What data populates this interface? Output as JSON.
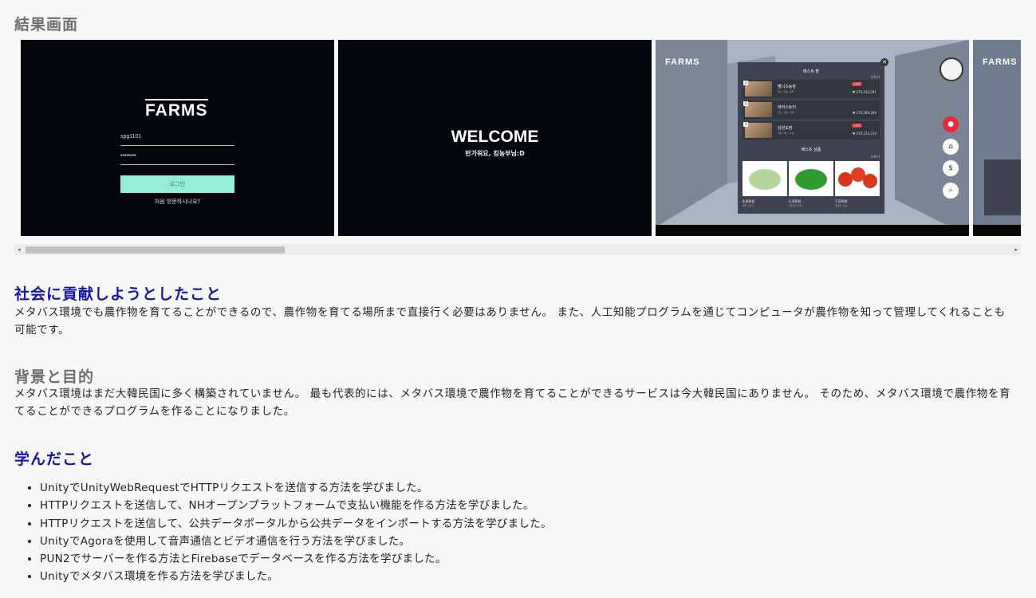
{
  "result": {
    "title": "結果画面"
  },
  "screens": {
    "login": {
      "logo": "FARMS",
      "id_value": "spg1101",
      "password_mask": "••••••••",
      "login_button": "로그인",
      "help_text": "처음 방문하시나요?"
    },
    "welcome": {
      "title": "WELCOME",
      "subtitle": "반가워요, 킹농부님:D"
    },
    "store": {
      "logo": "FARMS",
      "panel_title": "베스트 팜",
      "more_label": "더보기",
      "sellers": [
        {
          "num": "1",
          "name": "밸니스농장",
          "sub": "채소, 과일, 곡류",
          "live": "LIVE",
          "likes": "♥ 370,334,291"
        },
        {
          "num": "2",
          "name": "파머스토리",
          "sub": "채소, 과일, 곡류",
          "likes": "♥ 370,289,289"
        },
        {
          "num": "3",
          "name": "강원도팜",
          "sub": "곡류, 채소, 과일",
          "live": "LIVE",
          "likes": "♥ 370,224,210"
        }
      ],
      "products_title": "베스트 상품",
      "products": [
        {
          "price": "8,000원",
          "name": "배추 1포기"
        },
        {
          "price": "2,300원",
          "name": "파프리카 2개"
        },
        {
          "price": "7,500원",
          "name": "토마토 1kg"
        }
      ],
      "close_icon": "close-icon",
      "side_icons": [
        "live-icon",
        "home-icon",
        "coin-icon",
        "search-icon"
      ]
    },
    "partial": {
      "logo": "FARMS"
    }
  },
  "sections": [
    {
      "title": "社会に貢献しようとしたこと",
      "title_color": "#1515a6",
      "body": "メタバス環境でも農作物を育てることができるので、農作物を育てる場所まで直接行く必要はありません。 また、人工知能プログラムを通じてコンピュータが農作物を知って管理してくれることも可能です。"
    },
    {
      "title": "背景と目的",
      "title_color": "#6f6f6f",
      "body": "メタバス環境はまだ大韓民国に多く構築されていません。 最も代表的には、メタバス環境で農作物を育てることができるサービスは今大韓民国にありません。 そのため、メタバス環境で農作物を育てることができるプログラムを作ることになりました。"
    },
    {
      "title": "学んだこと",
      "title_color": "#1515a6",
      "items": [
        "UnityでUnityWebRequestでHTTPリクエストを送信する方法を学びました。",
        "HTTPリクエストを送信して、NHオープンプラットフォームで支払い機能を作る方法を学びました。",
        "HTTPリクエストを送信して、公共データポータルから公共データをインポートする方法を学びました。",
        "UnityでAgoraを使用して音声通信とビデオ通信を行う方法を学びました。",
        "PUN2でサーバーを作る方法とFirebaseでデータベースを作る方法を学びました。",
        "Unityでメタバス環境を作る方法を学びました。"
      ]
    }
  ]
}
